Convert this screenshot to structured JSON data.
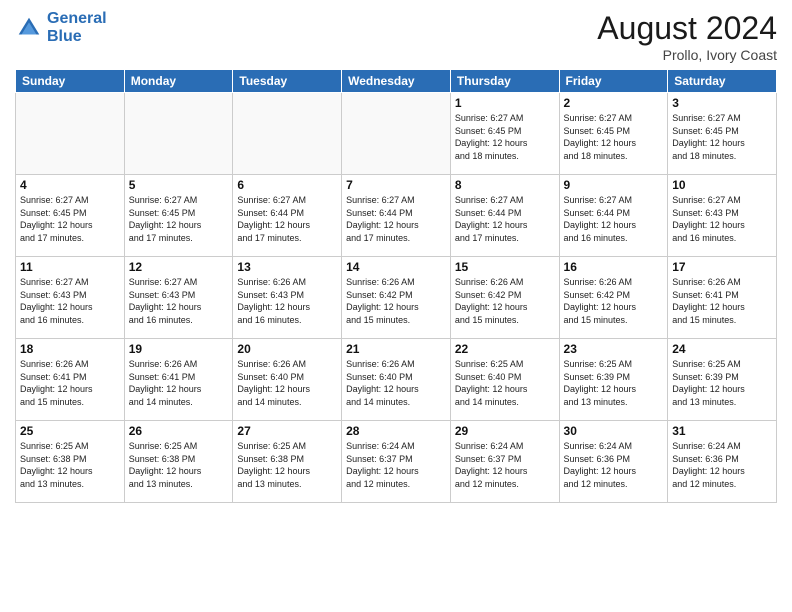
{
  "header": {
    "logo_line1": "General",
    "logo_line2": "Blue",
    "month_title": "August 2024",
    "location": "Prollo, Ivory Coast"
  },
  "weekdays": [
    "Sunday",
    "Monday",
    "Tuesday",
    "Wednesday",
    "Thursday",
    "Friday",
    "Saturday"
  ],
  "weeks": [
    [
      {
        "day": "",
        "info": ""
      },
      {
        "day": "",
        "info": ""
      },
      {
        "day": "",
        "info": ""
      },
      {
        "day": "",
        "info": ""
      },
      {
        "day": "1",
        "info": "Sunrise: 6:27 AM\nSunset: 6:45 PM\nDaylight: 12 hours\nand 18 minutes."
      },
      {
        "day": "2",
        "info": "Sunrise: 6:27 AM\nSunset: 6:45 PM\nDaylight: 12 hours\nand 18 minutes."
      },
      {
        "day": "3",
        "info": "Sunrise: 6:27 AM\nSunset: 6:45 PM\nDaylight: 12 hours\nand 18 minutes."
      }
    ],
    [
      {
        "day": "4",
        "info": "Sunrise: 6:27 AM\nSunset: 6:45 PM\nDaylight: 12 hours\nand 17 minutes."
      },
      {
        "day": "5",
        "info": "Sunrise: 6:27 AM\nSunset: 6:45 PM\nDaylight: 12 hours\nand 17 minutes."
      },
      {
        "day": "6",
        "info": "Sunrise: 6:27 AM\nSunset: 6:44 PM\nDaylight: 12 hours\nand 17 minutes."
      },
      {
        "day": "7",
        "info": "Sunrise: 6:27 AM\nSunset: 6:44 PM\nDaylight: 12 hours\nand 17 minutes."
      },
      {
        "day": "8",
        "info": "Sunrise: 6:27 AM\nSunset: 6:44 PM\nDaylight: 12 hours\nand 17 minutes."
      },
      {
        "day": "9",
        "info": "Sunrise: 6:27 AM\nSunset: 6:44 PM\nDaylight: 12 hours\nand 16 minutes."
      },
      {
        "day": "10",
        "info": "Sunrise: 6:27 AM\nSunset: 6:43 PM\nDaylight: 12 hours\nand 16 minutes."
      }
    ],
    [
      {
        "day": "11",
        "info": "Sunrise: 6:27 AM\nSunset: 6:43 PM\nDaylight: 12 hours\nand 16 minutes."
      },
      {
        "day": "12",
        "info": "Sunrise: 6:27 AM\nSunset: 6:43 PM\nDaylight: 12 hours\nand 16 minutes."
      },
      {
        "day": "13",
        "info": "Sunrise: 6:26 AM\nSunset: 6:43 PM\nDaylight: 12 hours\nand 16 minutes."
      },
      {
        "day": "14",
        "info": "Sunrise: 6:26 AM\nSunset: 6:42 PM\nDaylight: 12 hours\nand 15 minutes."
      },
      {
        "day": "15",
        "info": "Sunrise: 6:26 AM\nSunset: 6:42 PM\nDaylight: 12 hours\nand 15 minutes."
      },
      {
        "day": "16",
        "info": "Sunrise: 6:26 AM\nSunset: 6:42 PM\nDaylight: 12 hours\nand 15 minutes."
      },
      {
        "day": "17",
        "info": "Sunrise: 6:26 AM\nSunset: 6:41 PM\nDaylight: 12 hours\nand 15 minutes."
      }
    ],
    [
      {
        "day": "18",
        "info": "Sunrise: 6:26 AM\nSunset: 6:41 PM\nDaylight: 12 hours\nand 15 minutes."
      },
      {
        "day": "19",
        "info": "Sunrise: 6:26 AM\nSunset: 6:41 PM\nDaylight: 12 hours\nand 14 minutes."
      },
      {
        "day": "20",
        "info": "Sunrise: 6:26 AM\nSunset: 6:40 PM\nDaylight: 12 hours\nand 14 minutes."
      },
      {
        "day": "21",
        "info": "Sunrise: 6:26 AM\nSunset: 6:40 PM\nDaylight: 12 hours\nand 14 minutes."
      },
      {
        "day": "22",
        "info": "Sunrise: 6:25 AM\nSunset: 6:40 PM\nDaylight: 12 hours\nand 14 minutes."
      },
      {
        "day": "23",
        "info": "Sunrise: 6:25 AM\nSunset: 6:39 PM\nDaylight: 12 hours\nand 13 minutes."
      },
      {
        "day": "24",
        "info": "Sunrise: 6:25 AM\nSunset: 6:39 PM\nDaylight: 12 hours\nand 13 minutes."
      }
    ],
    [
      {
        "day": "25",
        "info": "Sunrise: 6:25 AM\nSunset: 6:38 PM\nDaylight: 12 hours\nand 13 minutes."
      },
      {
        "day": "26",
        "info": "Sunrise: 6:25 AM\nSunset: 6:38 PM\nDaylight: 12 hours\nand 13 minutes."
      },
      {
        "day": "27",
        "info": "Sunrise: 6:25 AM\nSunset: 6:38 PM\nDaylight: 12 hours\nand 13 minutes."
      },
      {
        "day": "28",
        "info": "Sunrise: 6:24 AM\nSunset: 6:37 PM\nDaylight: 12 hours\nand 12 minutes."
      },
      {
        "day": "29",
        "info": "Sunrise: 6:24 AM\nSunset: 6:37 PM\nDaylight: 12 hours\nand 12 minutes."
      },
      {
        "day": "30",
        "info": "Sunrise: 6:24 AM\nSunset: 6:36 PM\nDaylight: 12 hours\nand 12 minutes."
      },
      {
        "day": "31",
        "info": "Sunrise: 6:24 AM\nSunset: 6:36 PM\nDaylight: 12 hours\nand 12 minutes."
      }
    ]
  ]
}
